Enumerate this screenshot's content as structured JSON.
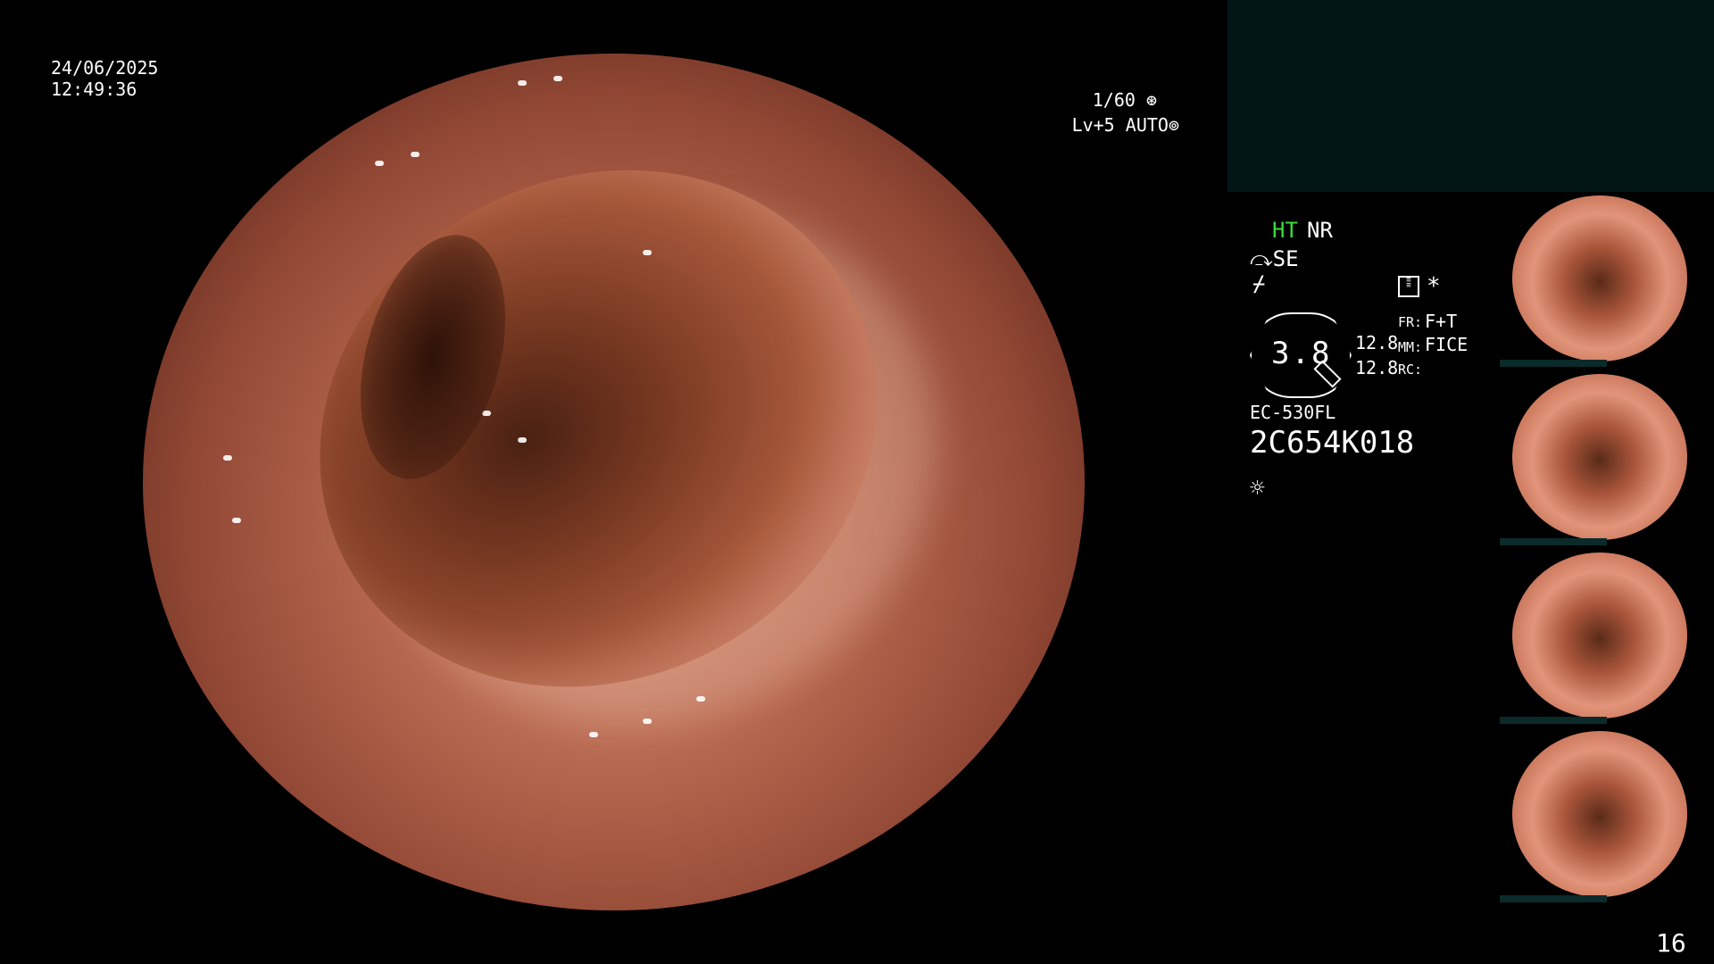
{
  "overlay": {
    "date": "24/06/2025",
    "time": "12:49:36",
    "shutter": "1/60",
    "level": "Lv+5",
    "auto": "AUTO"
  },
  "status": {
    "ht": "HT",
    "nr": "NR",
    "se": "SE",
    "star": "*",
    "magnification": "3.8",
    "val1": "12.8",
    "val2": "12.8",
    "fr_label": "FR:",
    "fr_value": "F+T",
    "mm_label": "MM:",
    "mm_value": "FICE",
    "rc_label": "RC:",
    "scope_model": "EC-530FL",
    "scope_serial": "2C654K018"
  },
  "page_number": "16",
  "colors": {
    "ht_green": "#3cdc3c",
    "panel_teal": "#021616"
  },
  "icons": [
    "shutter-icon",
    "auto-iris-icon",
    "scope-icon",
    "flash-icon",
    "menu-list-icon",
    "light-icon"
  ]
}
